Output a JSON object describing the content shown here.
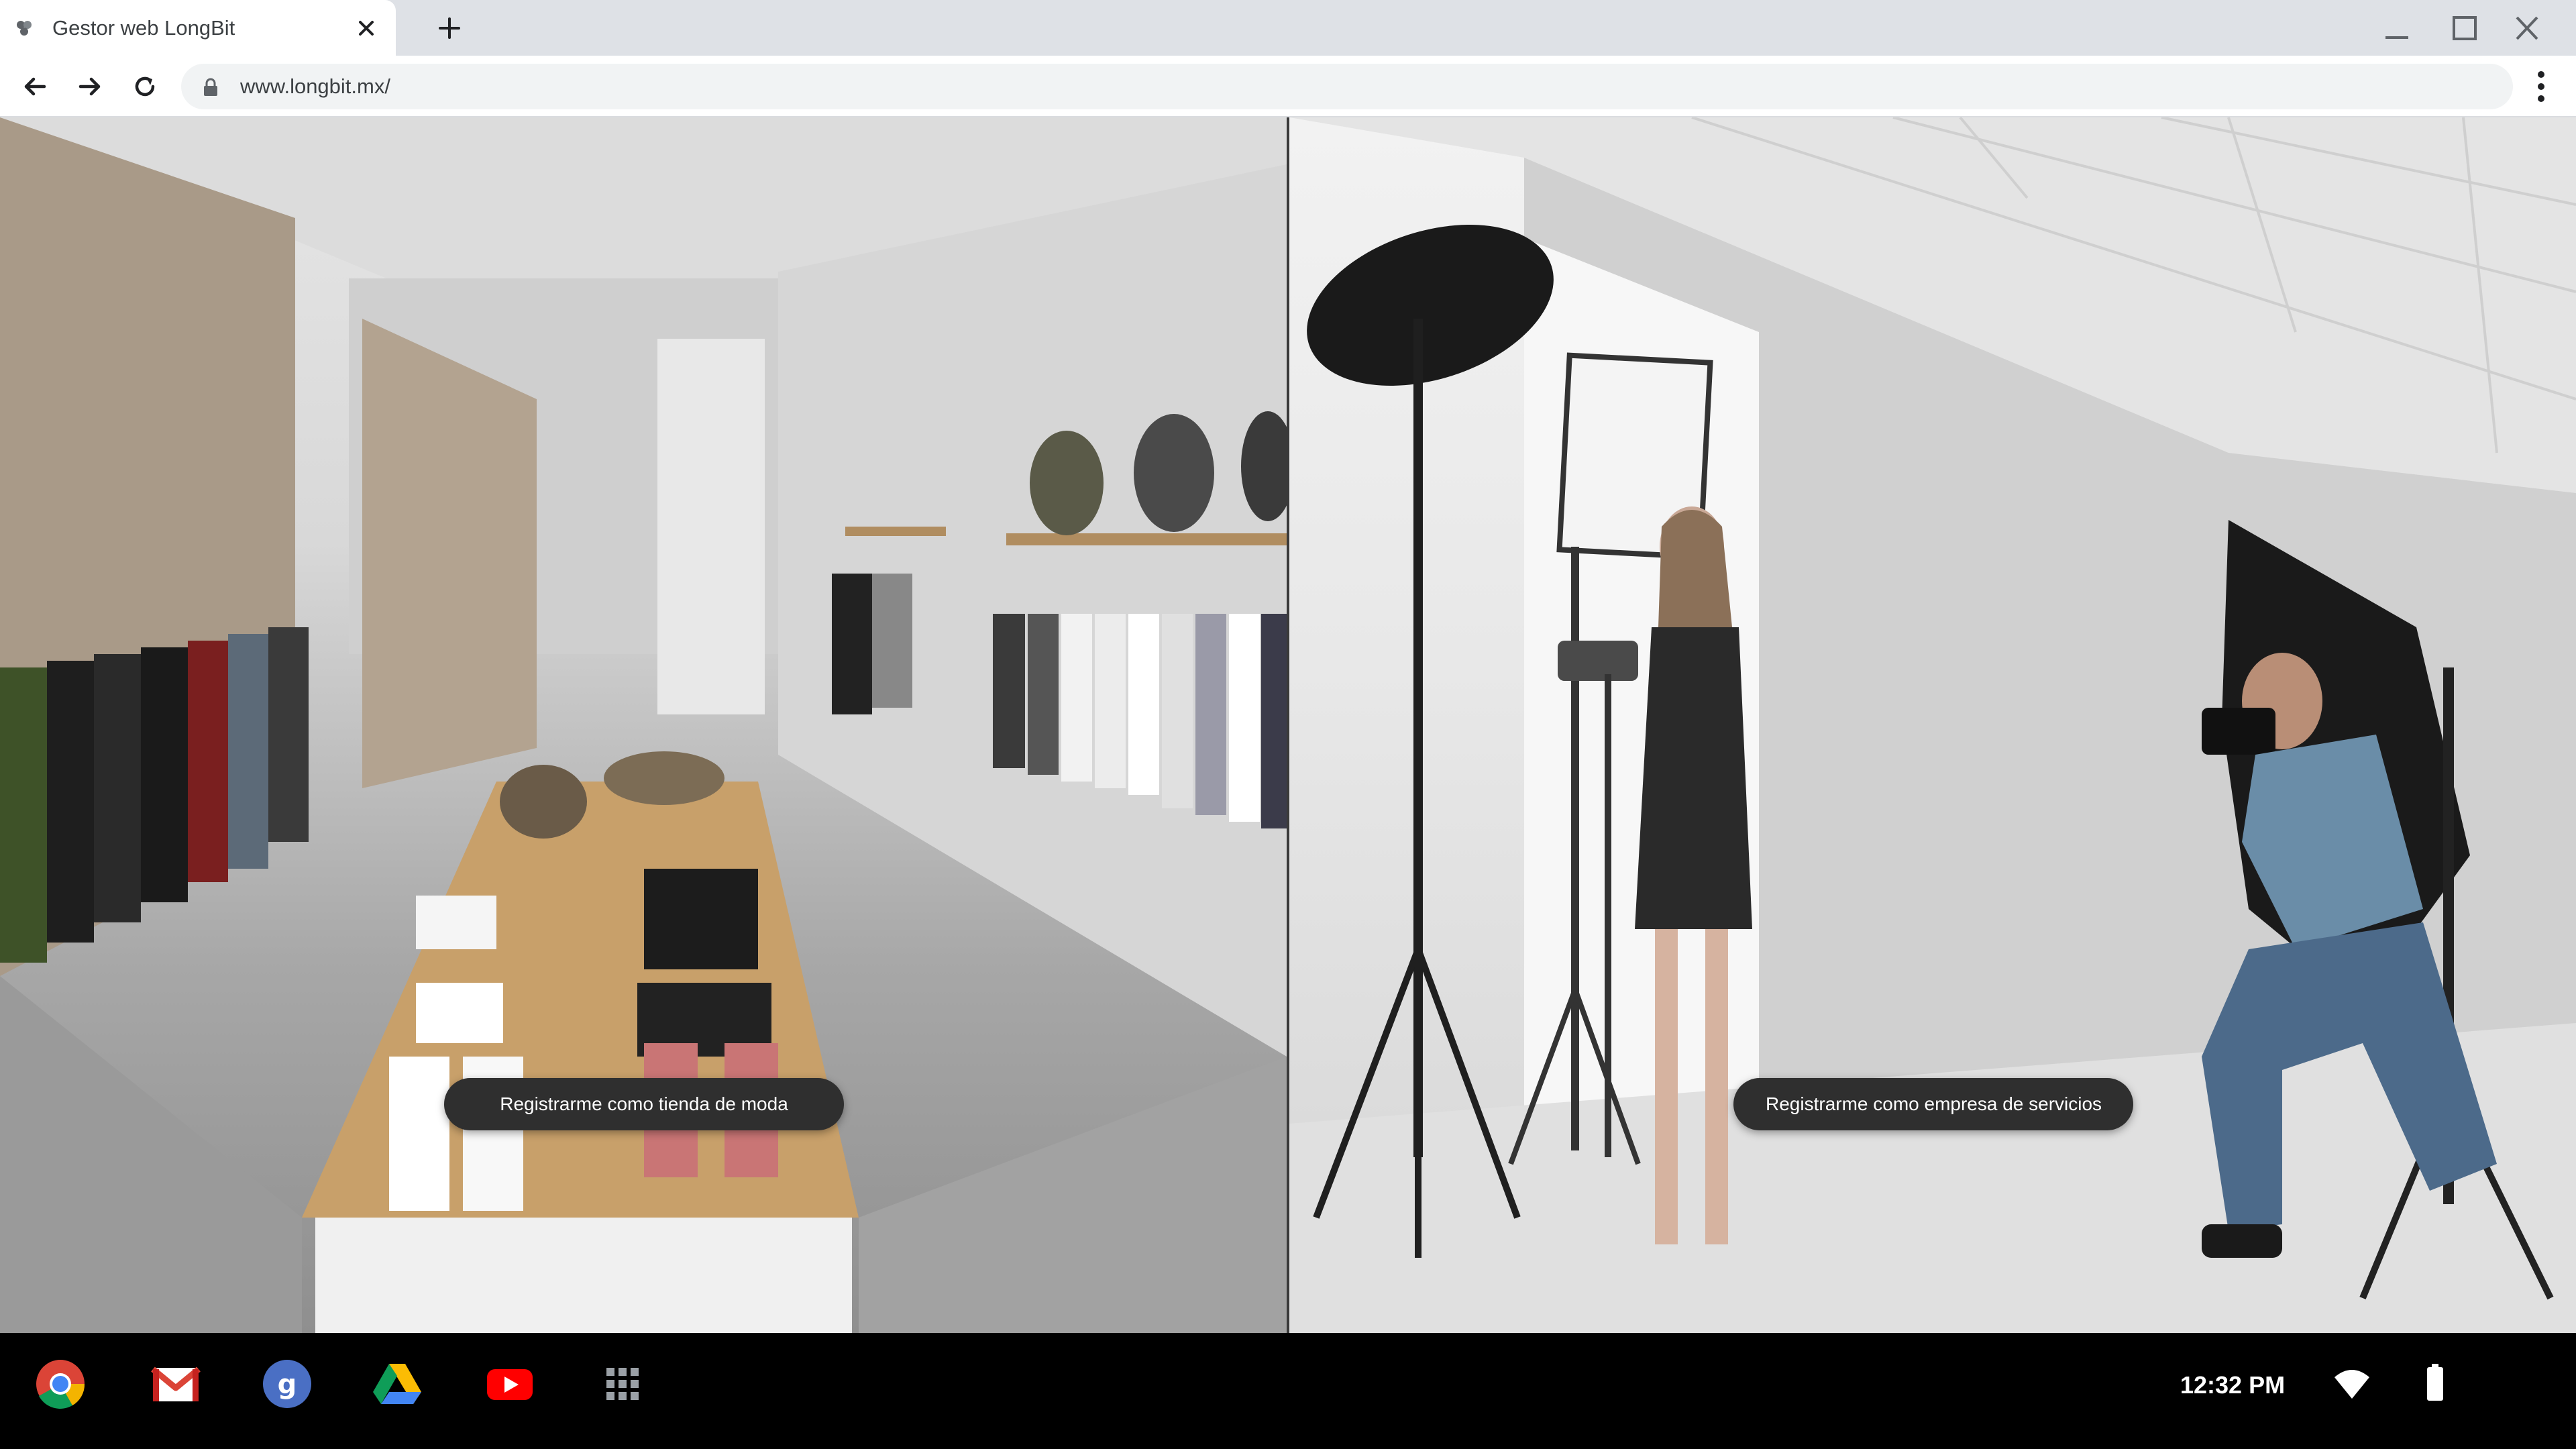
{
  "browser": {
    "tab_title": "Gestor web LongBit",
    "url": "www.longbit.mx/"
  },
  "page": {
    "left_panel": {
      "image": "fashion-store-interior",
      "button_label": "Registrarme como tienda de moda"
    },
    "right_panel": {
      "image": "photo-studio-shoot",
      "button_label": "Registrarme como empresa de servicios"
    }
  },
  "shelf": {
    "apps": [
      "chrome-icon",
      "gmail-icon",
      "google-search-icon",
      "drive-icon",
      "youtube-icon",
      "app-launcher-icon"
    ],
    "time": "12:32 PM"
  },
  "colors": {
    "tabstrip": "#dee1e6",
    "button_bg": "#2f2f2f",
    "shelf_bg": "#000000"
  }
}
